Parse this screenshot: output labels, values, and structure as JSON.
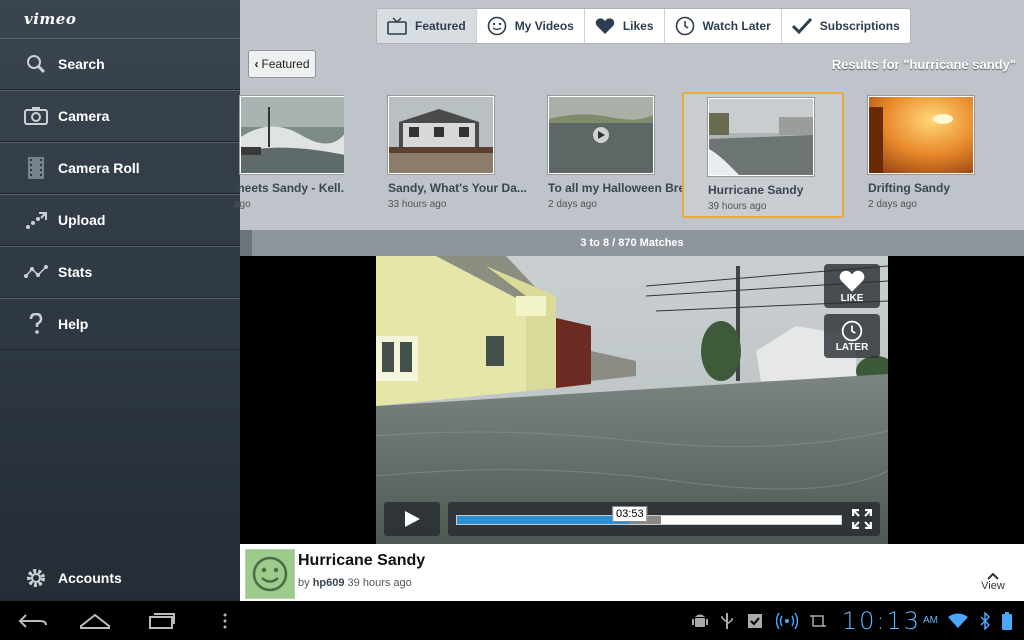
{
  "sidebar": {
    "logo": "vimeo",
    "items": [
      {
        "label": "Search",
        "icon": "search-icon"
      },
      {
        "label": "Camera",
        "icon": "camera-icon"
      },
      {
        "label": "Camera Roll",
        "icon": "film-icon"
      },
      {
        "label": "Upload",
        "icon": "upload-icon"
      },
      {
        "label": "Stats",
        "icon": "stats-icon"
      },
      {
        "label": "Help",
        "icon": "help-icon"
      }
    ],
    "accounts_label": "Accounts"
  },
  "tabs": [
    {
      "label": "Featured",
      "active": true
    },
    {
      "label": "My Videos",
      "active": false
    },
    {
      "label": "Likes",
      "active": false
    },
    {
      "label": "Watch Later",
      "active": false
    },
    {
      "label": "Subscriptions",
      "active": false
    }
  ],
  "back_button": "Featured",
  "results_title": "Results for \"hurricane sandy\"",
  "videos": [
    {
      "title": "meets Sandy - Kell...",
      "meta": "ago"
    },
    {
      "title": "Sandy, What's Your Da...",
      "meta": "33 hours ago"
    },
    {
      "title": "To all my Halloween Bre...",
      "meta": "2 days ago"
    },
    {
      "title": "Hurricane Sandy",
      "meta": "39 hours ago",
      "selected": true
    },
    {
      "title": "Drifting Sandy",
      "meta": "2 days ago"
    }
  ],
  "matches": "3 to 8 / 870 Matches",
  "player": {
    "like_label": "LIKE",
    "later_label": "LATER",
    "current_time": "03:53",
    "progress": 0.45,
    "buffered": 0.53
  },
  "info": {
    "title": "Hurricane Sandy",
    "by": "by",
    "user": "hp609",
    "time": "39 hours ago",
    "view_label": "View"
  },
  "status": {
    "time": "10:13",
    "ampm": "AM"
  }
}
